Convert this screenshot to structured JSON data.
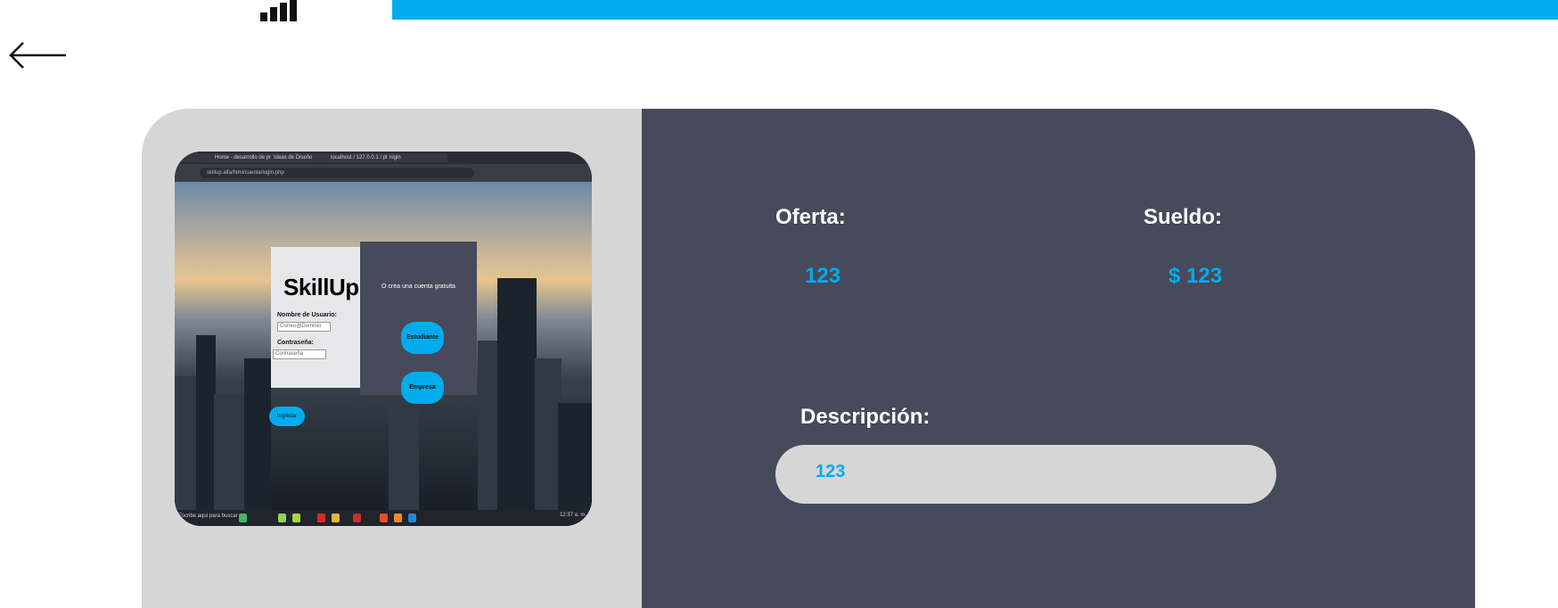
{
  "header": {
    "logo_icon": "signal-bars-icon",
    "accent_color": "#00acec",
    "back_icon": "arrow-left-icon"
  },
  "screenshot": {
    "tabs": [
      "",
      "Home - desarrollo de proy...",
      "Ideas de Diseño",
      "localhost / 127.0.0.1 / php...",
      "login"
    ],
    "url": "skillup.alfa/html/cuenta/login.php",
    "login": {
      "brand": "SkillUp",
      "user_label": "Nombre de Usuario:",
      "user_placeholder": "Correo@Dominio",
      "pass_label": "Contraseña:",
      "pass_placeholder": "Contraseña",
      "submit": "Ingresar"
    },
    "signup": {
      "text": "O crea una cuenta gratuita",
      "student": "Estudiante",
      "company": "Empresa"
    },
    "taskbar_search": "Escribe aquí para buscar",
    "clock": "12:37 a. m."
  },
  "offer": {
    "offer_label": "Oferta:",
    "offer_value": "123",
    "salary_label": "Sueldo:",
    "salary_value": "$ 123",
    "description_label": "Descripción:",
    "description_value": "123"
  },
  "colors": {
    "card_left": "#d6d6d6",
    "card_right": "#474a5a",
    "accent": "#00acec"
  }
}
